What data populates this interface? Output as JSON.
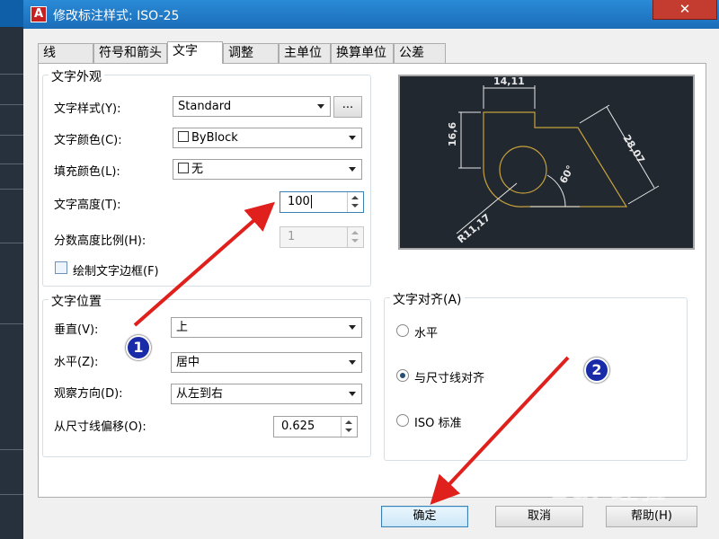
{
  "window": {
    "title": "修改标注样式: ISO-25",
    "close_glyph": "✕",
    "app_icon_glyph": "A"
  },
  "tabs": [
    {
      "label": "线"
    },
    {
      "label": "符号和箭头"
    },
    {
      "label": "文字"
    },
    {
      "label": "调整"
    },
    {
      "label": "主单位"
    },
    {
      "label": "换算单位"
    },
    {
      "label": "公差"
    }
  ],
  "text_appearance": {
    "legend": "文字外观",
    "style_label": "文字样式(Y):",
    "style_value": "Standard",
    "style_browse": "...",
    "color_label": "文字颜色(C):",
    "color_value": "ByBlock",
    "fill_label": "填充颜色(L):",
    "fill_value": "无",
    "height_label": "文字高度(T):",
    "height_value": "100",
    "fraction_label": "分数高度比例(H):",
    "fraction_value": "1",
    "frame_label": "绘制文字边框(F)"
  },
  "text_placement": {
    "legend": "文字位置",
    "vertical_label": "垂直(V):",
    "vertical_value": "上",
    "horizontal_label": "水平(Z):",
    "horizontal_value": "居中",
    "view_label": "观察方向(D):",
    "view_value": "从左到右",
    "offset_label": "从尺寸线偏移(O):",
    "offset_value": "0.625"
  },
  "text_alignment": {
    "legend": "文字对齐(A)",
    "options": [
      {
        "label": "水平",
        "selected": false
      },
      {
        "label": "与尺寸线对齐",
        "selected": true
      },
      {
        "label": "ISO 标准",
        "selected": false
      }
    ]
  },
  "preview": {
    "dim_top": "14,11",
    "dim_left": "16,6",
    "dim_right": "28,07",
    "dim_angle": "60°",
    "dim_radius": "R11,17",
    "line_color": "#c8a23c",
    "dim_color": "#e8e8e8"
  },
  "buttons": {
    "ok": "确定",
    "cancel": "取消",
    "help": "帮助(H)"
  },
  "annotations": {
    "marker1": "1",
    "marker2": "2",
    "arrow_color": "#e0201c"
  },
  "watermark": "Bai 经验"
}
